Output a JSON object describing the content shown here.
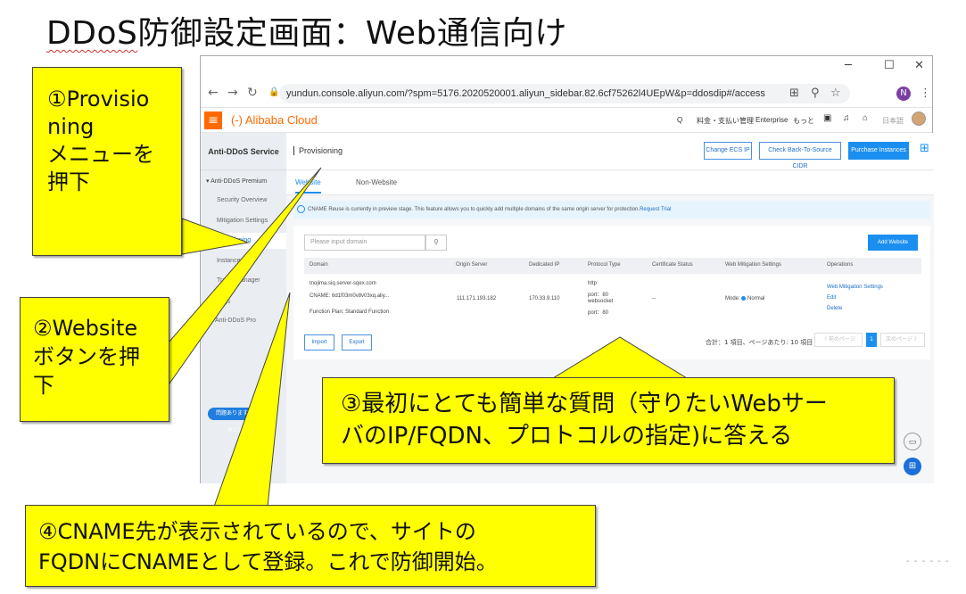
{
  "slide": {
    "title": "DDoS防御設定画面：Web通信向け",
    "title_ddos": "DDoS",
    "title_rest": "防御設定画面：Web通信向け"
  },
  "browser": {
    "url": "yundun.console.aliyun.com/?spm=5176.2020520001.aliyun_sidebar.82.6cf75262l4UEpW&p=ddosdip#/access",
    "window_minimize": "─",
    "window_maximize": "☐",
    "window_close": "✕",
    "profile_initial": "N"
  },
  "console": {
    "brand": "(-) Alibaba Cloud",
    "topnav": {
      "search": "Q",
      "billing": "料金・支払い管理",
      "enterprise": "Enterprise",
      "more": "もっと",
      "language": "日本語"
    },
    "sidebar": {
      "title": "Anti-DDoS Service",
      "group1": "▾  Anti-DDoS Premium",
      "items": [
        "Security Overview",
        "Mitigation Settings",
        "Provisioning",
        "Instances",
        "Traffic Manager",
        "Logs"
      ],
      "group2": "Anti-DDoS Pro",
      "help": "問題ありますか。専門",
      "help2": "家と話す！"
    },
    "header": {
      "title": "Provisioning",
      "btn_change_ecs": "Change ECS IP",
      "btn_check_cidr": "Check Back-To-Source CIDR",
      "btn_purchase": "Purchase Instances"
    },
    "tabs": [
      "Website",
      "Non-Website"
    ],
    "notice": "CNAME Reuse is currently in preview stage. This feature allows you to quickly add multiple domains of the same origin server for protection.",
    "notice_link": "Request Trial",
    "search_placeholder": "Please input domain",
    "add_website": "Add Website",
    "table": {
      "headers": [
        "Domain",
        "Origin Server",
        "Dedicated IP",
        "Protocol Type",
        "Certificate Status",
        "Web Mitigation Settings",
        "Operations"
      ],
      "row": {
        "domain": "tnojima.siq.server-sqex.com",
        "cname": "CNAME: 6d1f03m0v8v03xq.aliy...",
        "plan": "Function Plan: Standard Function",
        "origin": "111.171.193.182",
        "dedicated": "170.33.9.110",
        "proto1": "http",
        "proto2": "port：80",
        "proto3": "websocket",
        "proto4": "port：80",
        "cert": "--",
        "mode": "Mode:",
        "mode_value": "Normal",
        "op1": "Web Mitigation Settings",
        "op2": "Edit",
        "op3": "Delete"
      }
    },
    "import": "Import",
    "export": "Export",
    "pager_text": "合計：1 項目、ページあたり: 10 項目",
    "prev": "〈 前のページ",
    "page": "1",
    "next": "次のページ 〉"
  },
  "callouts": {
    "c1": [
      "①Provisio",
      "ning",
      "メニューを",
      "押下"
    ],
    "c2": [
      "②Website",
      "ボタンを押",
      "下"
    ],
    "c3": [
      "③最初にとても簡単な質問（守りたいWebサー",
      "バのIP/FQDN、プロトコルの指定)に答える"
    ],
    "c4": [
      "④CNAME先が表示されているので、サイトの",
      "FQDNにCNAMEとして登録。これで防御開始。"
    ]
  }
}
